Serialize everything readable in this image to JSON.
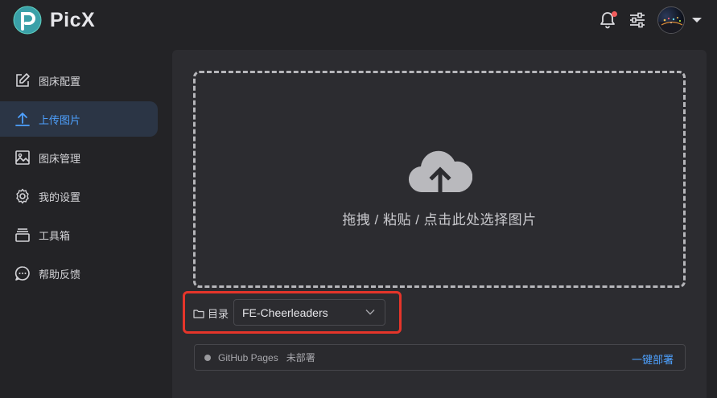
{
  "app": {
    "name": "PicX"
  },
  "header": {
    "notification_icon": "bell-icon",
    "notification_indicator_color": "#f25d5d",
    "settings_icon": "sliders-icon",
    "avatar_icon": "avatar",
    "dropdown_icon": "caret-down-icon"
  },
  "sidebar": {
    "items": [
      {
        "label": "图床配置",
        "icon": "edit-icon",
        "active": false
      },
      {
        "label": "上传图片",
        "icon": "upload-icon",
        "active": true
      },
      {
        "label": "图床管理",
        "icon": "image-icon",
        "active": false
      },
      {
        "label": "我的设置",
        "icon": "gear-icon",
        "active": false
      },
      {
        "label": "工具箱",
        "icon": "toolbox-icon",
        "active": false
      },
      {
        "label": "帮助反馈",
        "icon": "chat-icon",
        "active": false
      }
    ]
  },
  "upload": {
    "drop_text": "拖拽 / 粘贴 / 点击此处选择图片",
    "icon": "cloud-upload-icon"
  },
  "directory": {
    "label": "目录",
    "selected": "FE-Cheerleaders",
    "highlight_color": "#e5352a"
  },
  "deploy": {
    "platform": "GitHub Pages",
    "status": "未部署",
    "action_label": "一键部署"
  },
  "colors": {
    "accent": "#4ea1ff",
    "background": "#232326",
    "panel": "#2c2c30"
  }
}
